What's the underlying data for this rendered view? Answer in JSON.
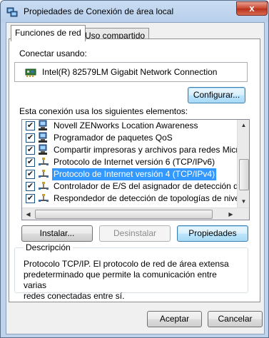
{
  "window": {
    "title": "Propiedades de Conexión de área local",
    "close_label": "x"
  },
  "tabs": [
    {
      "label": "Funciones de red",
      "active": true
    },
    {
      "label": "Uso compartido",
      "active": false
    }
  ],
  "connect_using": {
    "label": "Conectar usando:",
    "adapter": "Intel(R) 82579LM Gigabit Network Connection",
    "configure_button": "Configurar..."
  },
  "elements": {
    "label": "Esta conexión usa los siguientes elementos:",
    "items": [
      {
        "label": "Novell ZENworks Location Awareness",
        "checked": true,
        "icon": "network-client-icon",
        "selected": false
      },
      {
        "label": "Programador de paquetes QoS",
        "checked": true,
        "icon": "network-client-icon",
        "selected": false
      },
      {
        "label": "Compartir impresoras y archivos para redes Microsoft",
        "checked": true,
        "icon": "network-client-icon",
        "selected": false
      },
      {
        "label": "Protocolo de Internet versión 6 (TCP/IPv6)",
        "checked": true,
        "icon": "protocol-icon",
        "selected": false
      },
      {
        "label": "Protocolo de Internet versión 4 (TCP/IPv4)",
        "checked": true,
        "icon": "protocol-icon",
        "selected": true
      },
      {
        "label": "Controlador de E/S del asignador de detección de topo",
        "checked": true,
        "icon": "protocol-icon",
        "selected": false
      },
      {
        "label": "Respondedor de detección de topologías de nivel de v",
        "checked": true,
        "icon": "protocol-icon",
        "selected": false
      }
    ]
  },
  "actions": {
    "install": "Instalar...",
    "uninstall": "Desinstalar",
    "properties": "Propiedades"
  },
  "description": {
    "legend": "Descripción",
    "lines": [
      "Protocolo TCP/IP. El protocolo de red de área extensa",
      "predeterminado que permite la comunicación entre varias",
      "redes conectadas entre sí."
    ]
  },
  "footer": {
    "ok": "Aceptar",
    "cancel": "Cancelar"
  },
  "colors": {
    "selection": "#3399ff",
    "title_bar": "#bfd3ec",
    "close_button": "#c7452d"
  }
}
